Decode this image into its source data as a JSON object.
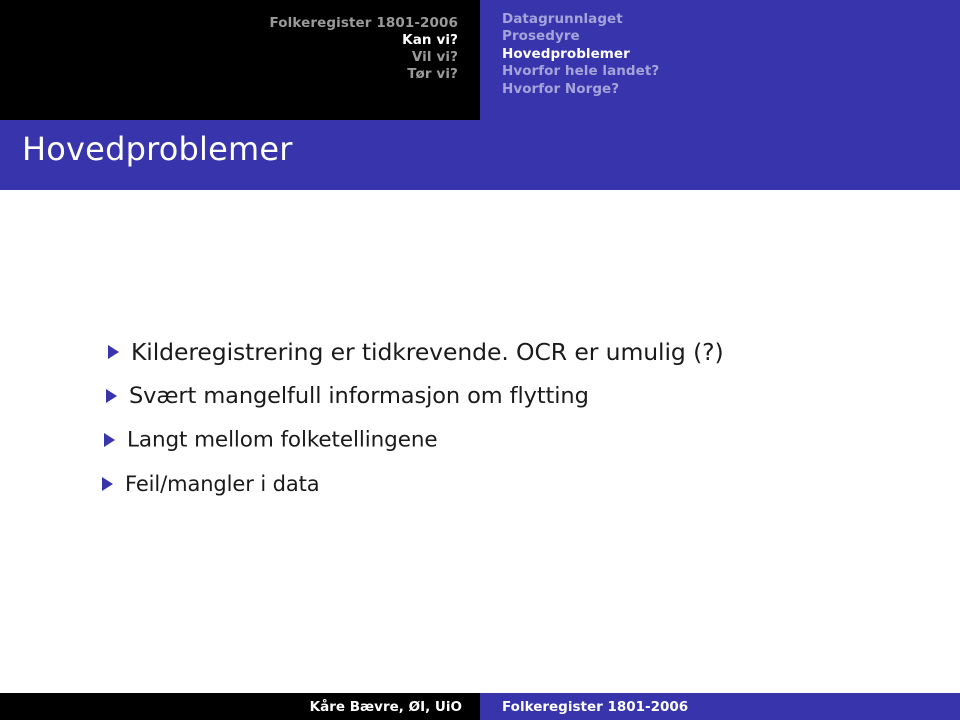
{
  "slide": {
    "frame_title": "Hovedproblemer",
    "colors": {
      "accent_blue": "#3734ac",
      "header_black": "#000000",
      "background": "#ffffff",
      "nav_inactive": "#a5a4da",
      "nav_active": "#ffffff",
      "meta_inactive": "#9a9a9a",
      "meta_active": "#ffffff",
      "bullet_marker": "#3734ac",
      "body_text": "#1a1a1a"
    }
  },
  "header": {
    "talk_meta": [
      {
        "label": "Folkeregister 1801-2006",
        "active": false
      },
      {
        "label": "Kan vi?",
        "active": true
      },
      {
        "label": "Vil vi?",
        "active": false
      },
      {
        "label": "Tør vi?",
        "active": false
      }
    ]
  },
  "nav": {
    "items": [
      {
        "label": "Datagrunnlaget",
        "active": false
      },
      {
        "label": "Prosedyre",
        "active": false
      },
      {
        "label": "Hovedproblemer",
        "active": true
      },
      {
        "label": "Hvorfor hele landet?",
        "active": false
      },
      {
        "label": "Hvorfor Norge?",
        "active": false
      }
    ]
  },
  "body": {
    "bullets": [
      {
        "text": "Kilderegistrering er tidkrevende. OCR er umulig (?)"
      },
      {
        "text": "Svært mangelfull informasjon om flytting"
      },
      {
        "text": "Langt mellom folketellingene"
      },
      {
        "text": "Feil/mangler i data"
      }
    ]
  },
  "footer": {
    "author": "Kåre Bævre, ØI, UiO",
    "talk": "Folkeregister 1801-2006"
  }
}
